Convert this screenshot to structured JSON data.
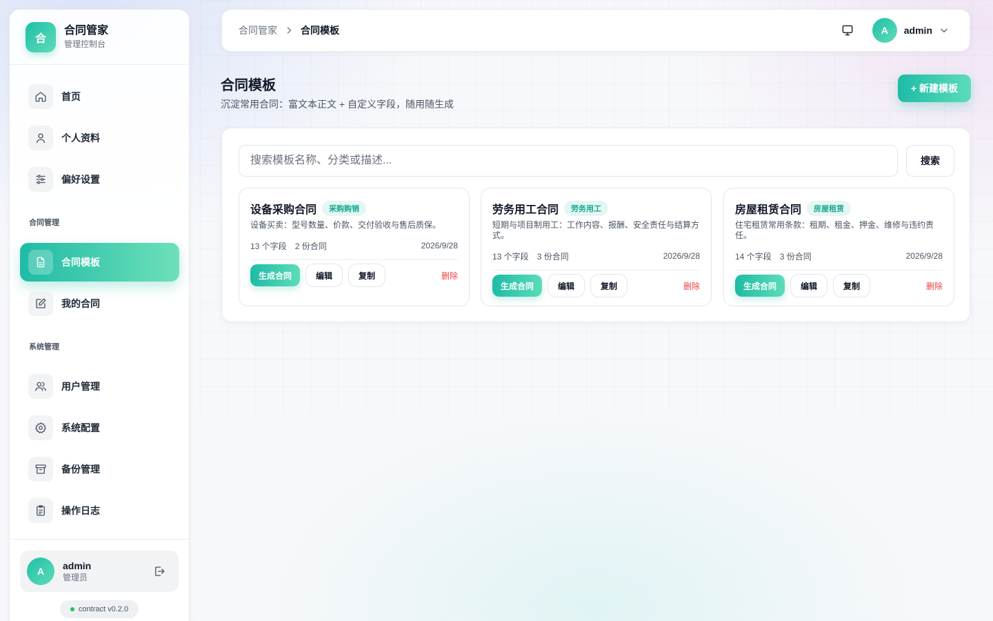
{
  "brand": {
    "logo_char": "合",
    "title": "合同管家",
    "subtitle": "管理控制台"
  },
  "sidebar": {
    "items": [
      {
        "label": "首页",
        "icon": "home-icon"
      },
      {
        "label": "个人资料",
        "icon": "user-icon"
      },
      {
        "label": "偏好设置",
        "icon": "sliders-icon"
      }
    ],
    "section_contracts": "合同管理",
    "contract_items": [
      {
        "label": "合同模板",
        "icon": "document-icon",
        "active": true
      },
      {
        "label": "我的合同",
        "icon": "edit-icon"
      }
    ],
    "section_system": "系统管理",
    "system_items": [
      {
        "label": "用户管理",
        "icon": "users-icon"
      },
      {
        "label": "系统配置",
        "icon": "gear-icon"
      },
      {
        "label": "备份管理",
        "icon": "archive-icon"
      },
      {
        "label": "操作日志",
        "icon": "clipboard-icon"
      }
    ]
  },
  "user": {
    "avatar": "A",
    "name": "admin",
    "role": "管理员"
  },
  "version": "contract v0.2.0",
  "topbar": {
    "breadcrumb_root": "合同管家",
    "breadcrumb_current": "合同模板",
    "username": "admin",
    "avatar": "A"
  },
  "page": {
    "title": "合同模板",
    "description": "沉淀常用合同：富文本正文 + 自定义字段，随用随生成",
    "new_button": "新建模板",
    "new_button_icon": "+"
  },
  "search": {
    "placeholder": "搜索模板名称、分类或描述...",
    "value": "",
    "button": "搜索"
  },
  "cards": [
    {
      "title": "设备采购合同",
      "tag": "采购购销",
      "description": "设备买卖：型号数量、价款、交付验收与售后质保。",
      "fields": "13 个字段",
      "contracts": "2 份合同",
      "date": "2026/9/28",
      "generate": "生成合同",
      "edit": "编辑",
      "copy": "复制",
      "delete": "删除"
    },
    {
      "title": "劳务用工合同",
      "tag": "劳务用工",
      "description": "短期与项目制用工：工作内容、报酬、安全责任与结算方式。",
      "fields": "13 个字段",
      "contracts": "3 份合同",
      "date": "2026/9/28",
      "generate": "生成合同",
      "edit": "编辑",
      "copy": "复制",
      "delete": "删除"
    },
    {
      "title": "房屋租赁合同",
      "tag": "房屋租赁",
      "description": "住宅租赁常用条款：租期、租金、押金、维修与违约责任。",
      "fields": "14 个字段",
      "contracts": "3 份合同",
      "date": "2026/9/28",
      "generate": "生成合同",
      "edit": "编辑",
      "copy": "复制",
      "delete": "删除"
    }
  ],
  "colors": {
    "accent": "#1fbba6",
    "accent_light": "#5cdcb9",
    "danger": "#ef4444",
    "tag_bg": "#e4f7f2"
  }
}
